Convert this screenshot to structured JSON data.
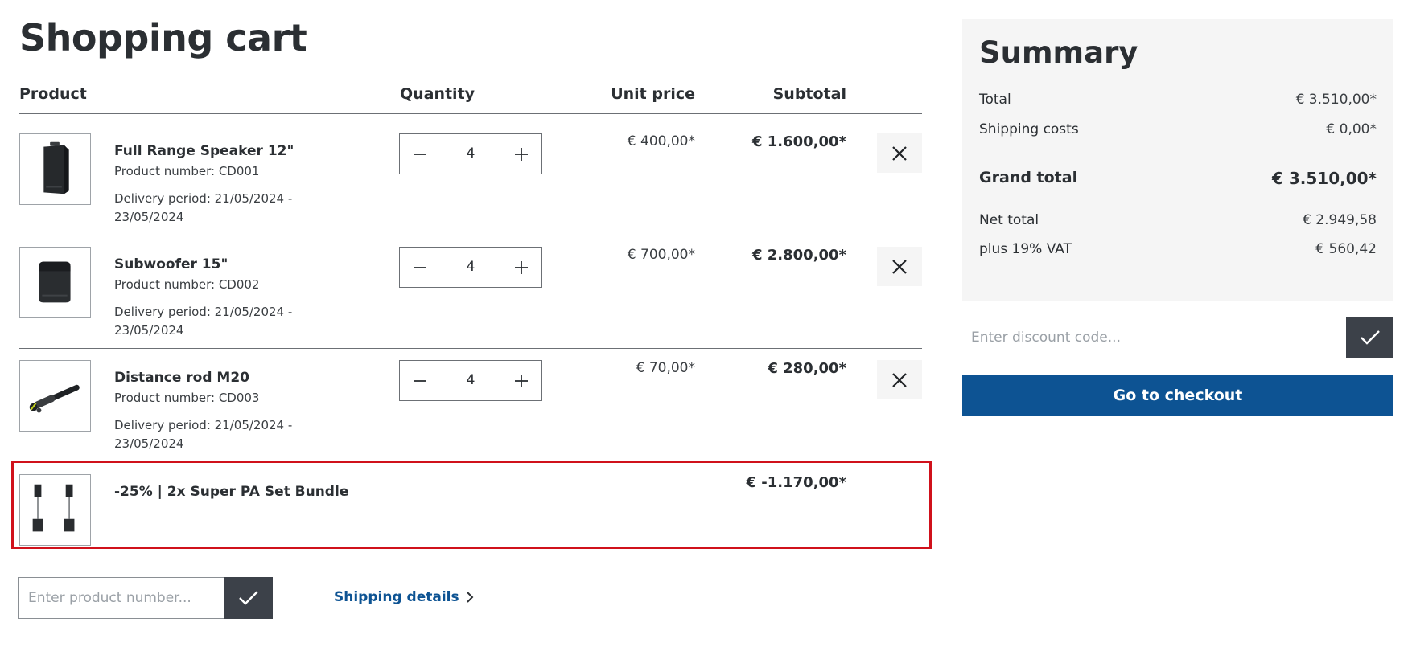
{
  "page": {
    "title": "Shopping cart"
  },
  "table": {
    "headers": {
      "product": "Product",
      "quantity": "Quantity",
      "unit_price": "Unit price",
      "subtotal": "Subtotal"
    },
    "items": [
      {
        "name": "Full Range Speaker 12\"",
        "number": "Product number: CD001",
        "delivery": "Delivery period: 21/05/2024 - 23/05/2024",
        "quantity": "4",
        "unit_price": "€ 400,00*",
        "subtotal": "€ 1.600,00*",
        "image_icon": "speaker-image"
      },
      {
        "name": "Subwoofer 15\"",
        "number": "Product number: CD002",
        "delivery": "Delivery period: 21/05/2024 - 23/05/2024",
        "quantity": "4",
        "unit_price": "€ 700,00*",
        "subtotal": "€ 2.800,00*",
        "image_icon": "subwoofer-image"
      },
      {
        "name": "Distance rod M20",
        "number": "Product number: CD003",
        "delivery": "Delivery period: 21/05/2024 - 23/05/2024",
        "quantity": "4",
        "unit_price": "€ 70,00*",
        "subtotal": "€ 280,00*",
        "image_icon": "rod-image"
      }
    ],
    "discount_row": {
      "name": "-25% | 2x Super PA Set Bundle",
      "subtotal": "€ -1.170,00*",
      "image_icon": "pa-set-image",
      "highlight_color": "#d0111b"
    }
  },
  "product_entry": {
    "placeholder": "Enter product number..."
  },
  "shipping_link": {
    "label": "Shipping details"
  },
  "summary": {
    "title": "Summary",
    "total_label": "Total",
    "total_value": "€ 3.510,00*",
    "shipping_label": "Shipping costs",
    "shipping_value": "€ 0,00*",
    "grand_label": "Grand total",
    "grand_value": "€ 3.510,00*",
    "net_label": "Net total",
    "net_value": "€ 2.949,58",
    "vat_label": "plus 19% VAT",
    "vat_value": "€ 560,42"
  },
  "discount": {
    "placeholder": "Enter discount code..."
  },
  "checkout": {
    "label": "Go to checkout"
  },
  "colors": {
    "accent": "#0d5393",
    "dark_button": "#3c4149",
    "summary_bg": "#f5f5f5"
  }
}
